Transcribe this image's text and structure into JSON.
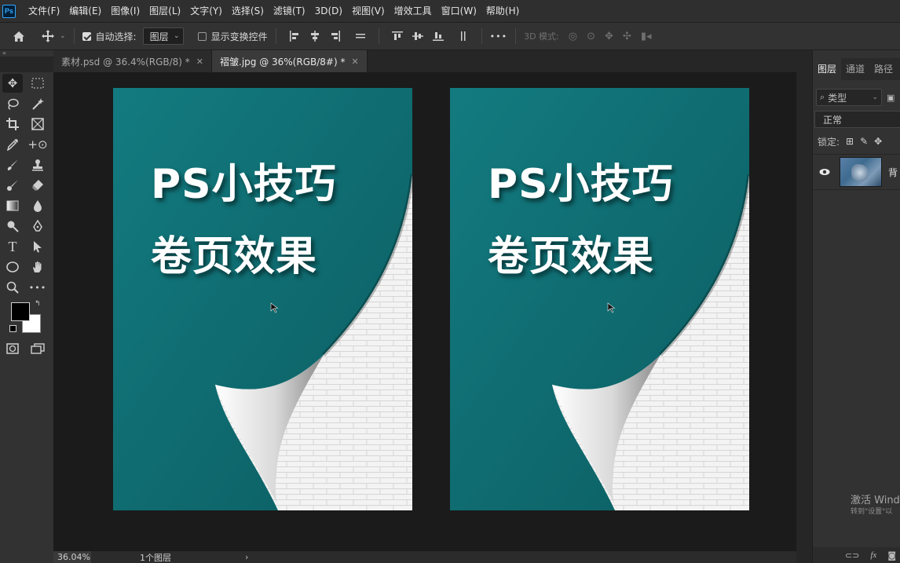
{
  "app": {
    "logo": "Ps"
  },
  "menu": [
    "文件(F)",
    "编辑(E)",
    "图像(I)",
    "图层(L)",
    "文字(Y)",
    "选择(S)",
    "滤镜(T)",
    "3D(D)",
    "视图(V)",
    "增效工具",
    "窗口(W)",
    "帮助(H)"
  ],
  "options": {
    "auto_select_label": "自动选择:",
    "auto_select_checked": true,
    "target_value": "图层",
    "show_transform_label": "显示变换控件",
    "show_transform_checked": false,
    "more_label": "•••",
    "mode_3d_label": "3D 模式:"
  },
  "tabs": [
    {
      "label": "素材.psd @ 36.4%(RGB/8) *",
      "active": false
    },
    {
      "label": "褶皱.jpg @ 36%(RGB/8#) *",
      "active": true
    }
  ],
  "collapse_glyph": "«",
  "documents": [
    {
      "title_line1": "PS小技巧",
      "title_line2": "卷页效果"
    },
    {
      "title_line1": "PS小技巧",
      "title_line2": "卷页效果"
    }
  ],
  "colors": {
    "teal": "#0f7377",
    "teal_dark": "#0a5457",
    "foreground": "#000000",
    "background": "#ffffff",
    "brick": "#f2f2f2"
  },
  "status": {
    "zoom": "36.04%",
    "info": "1个图层",
    "arrow": "›"
  },
  "panel": {
    "tabs": [
      "图层",
      "通道",
      "路径"
    ],
    "filter_label": "类型",
    "blend_mode": "正常",
    "lock_label": "锁定:",
    "layer_name": "背"
  },
  "watermark": {
    "line1": "激活 Wind",
    "line2": "转到\"设置\"以"
  },
  "icons": {
    "home": "home-icon",
    "move": "move-icon",
    "marquee": "marquee-icon",
    "lasso": "lasso-icon",
    "magic": "magic-wand-icon",
    "crop": "crop-icon",
    "eyedropper": "eyedropper-icon",
    "brush": "brush-icon",
    "stamp": "stamp-icon",
    "eraser": "eraser-icon",
    "gradient": "gradient-icon",
    "pen": "pen-icon",
    "text": "type-icon",
    "select": "path-select-icon",
    "ellipse": "ellipse-icon",
    "hand": "hand-icon",
    "zoom": "zoom-icon",
    "eye": "eye-icon"
  }
}
